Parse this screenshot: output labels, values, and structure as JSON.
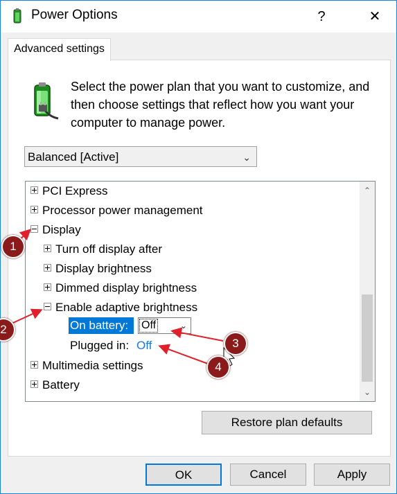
{
  "window": {
    "title": "Power Options"
  },
  "title_buttons": {
    "help": "?",
    "close": "✕"
  },
  "tab": {
    "label": "Advanced settings"
  },
  "intro_text": "Select the power plan that you want to customize, and then choose settings that reflect how you want your computer to manage power.",
  "plan_select": {
    "value": "Balanced [Active]"
  },
  "tree": {
    "items": [
      {
        "label": "PCI Express",
        "expander": "plus"
      },
      {
        "label": "Processor power management",
        "expander": "plus"
      },
      {
        "label": "Display",
        "expander": "minus"
      },
      {
        "label": "Turn off display after",
        "expander": "plus"
      },
      {
        "label": "Display brightness",
        "expander": "plus"
      },
      {
        "label": "Dimmed display brightness",
        "expander": "plus"
      },
      {
        "label": "Enable adaptive brightness",
        "expander": "minus"
      },
      {
        "label": "Multimedia settings",
        "expander": "plus"
      },
      {
        "label": "Battery",
        "expander": "plus"
      }
    ],
    "on_battery_label": "On battery:",
    "on_battery_value": "Off",
    "plugged_in_label": "Plugged in:",
    "plugged_in_value": "Off"
  },
  "buttons": {
    "restore": "Restore plan defaults",
    "ok": "OK",
    "cancel": "Cancel",
    "apply": "Apply"
  },
  "annotations": [
    "1",
    "2",
    "3",
    "4"
  ],
  "colors": {
    "accent": "#0078d7",
    "link": "#1c7ad6",
    "annotation": "#8b1a1a",
    "arrow": "#e0202a"
  }
}
